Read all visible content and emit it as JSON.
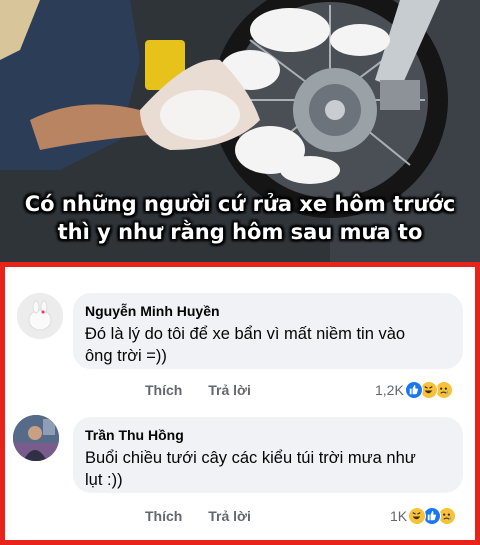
{
  "photo": {
    "caption_line1": "Có những người cứ rửa xe hôm trước",
    "caption_line2": "thì y như rằng hôm sau mưa to"
  },
  "comments": [
    {
      "author": "Nguyễn Minh Huyền",
      "text_line1": "Đó là lý do tôi để xe bẩn vì mất niềm tin vào",
      "text_line2": "ông trời =))",
      "like_label": "Thích",
      "reply_label": "Trả lời",
      "reaction_count": "1,2K",
      "reactions": [
        "like-icon",
        "haha-icon",
        "sad-icon"
      ]
    },
    {
      "author": "Trần Thu Hồng",
      "text_line1": "Buổi chiều tưới cây các kiểu túi trời mưa như",
      "text_line2": "lụt :))",
      "like_label": "Thích",
      "reply_label": "Trả lời",
      "reaction_count": "1K",
      "reactions": [
        "haha-icon",
        "like-icon",
        "sad-icon"
      ]
    }
  ],
  "colors": {
    "frame_border": "#e8231c",
    "bubble_bg": "#f0f2f5",
    "meta_text": "#65676b",
    "like_blue": "#1877f2",
    "emoji_yellow": "#f7c23a"
  }
}
